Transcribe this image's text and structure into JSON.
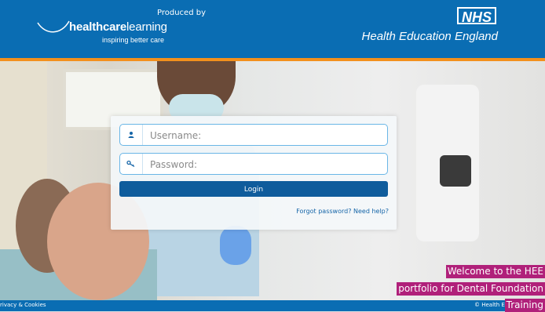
{
  "header": {
    "produced_by": "Produced by",
    "brand_bold": "healthcare",
    "brand_light": "learning",
    "brand_tagline": "inspiring better care",
    "nhs_logo": "NHS",
    "hee_title": "Health Education England",
    "background_color": "#0a6db3",
    "accent_color": "#f3901d"
  },
  "login": {
    "username_placeholder": "Username:",
    "password_placeholder": "Password:",
    "username_icon": "user-icon",
    "password_icon": "key-icon",
    "login_button": "Login",
    "forgot_password": "Forgot password?",
    "need_help": "Need help?",
    "button_color": "#0f5c9c"
  },
  "welcome": {
    "line1": "Welcome to the HEE",
    "line2": "portfolio for Dental Foundation",
    "line3": "Training",
    "highlight_color": "#b0207a"
  },
  "footer": {
    "privacy": "rivacy & Cookies",
    "copyright": "© Health E"
  }
}
